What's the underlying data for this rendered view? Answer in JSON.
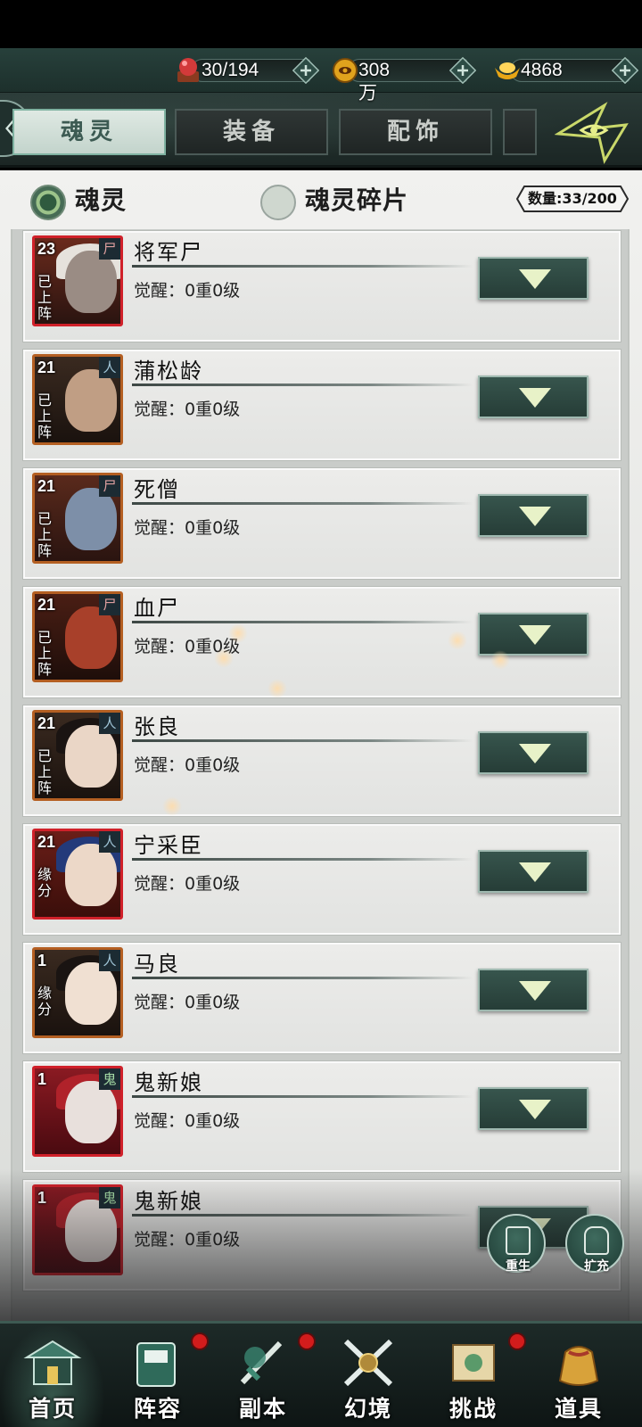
{
  "resources": [
    {
      "icon": "stamina-orb-icon",
      "value": "30/194"
    },
    {
      "icon": "coin-icon",
      "value": "308万"
    },
    {
      "icon": "gold-ingot-icon",
      "value": "4868"
    }
  ],
  "tabs": [
    {
      "label": "魂灵",
      "active": true
    },
    {
      "label": "装备",
      "active": false
    },
    {
      "label": "配饰",
      "active": false
    }
  ],
  "subtabs": [
    {
      "label": "魂灵",
      "selected": true
    },
    {
      "label": "魂灵碎片",
      "selected": false
    }
  ],
  "count_badge": "数量:33/200",
  "cards": [
    {
      "name": "将军尸",
      "level": "23",
      "status": "已上阵",
      "element": "尸",
      "awaken": "觉醒：0重0级"
    },
    {
      "name": "蒲松龄",
      "level": "21",
      "status": "已上阵",
      "element": "人",
      "awaken": "觉醒：0重0级"
    },
    {
      "name": "死僧",
      "level": "21",
      "status": "已上阵",
      "element": "尸",
      "awaken": "觉醒：0重0级"
    },
    {
      "name": "血尸",
      "level": "21",
      "status": "已上阵",
      "element": "尸",
      "awaken": "觉醒：0重0级"
    },
    {
      "name": "张良",
      "level": "21",
      "status": "已上阵",
      "element": "人",
      "awaken": "觉醒：0重0级"
    },
    {
      "name": "宁采臣",
      "level": "21",
      "status": "缘分",
      "element": "人",
      "awaken": "觉醒：0重0级"
    },
    {
      "name": "马良",
      "level": "1",
      "status": "缘分",
      "element": "人",
      "awaken": "觉醒：0重0级"
    },
    {
      "name": "鬼新娘",
      "level": "1",
      "status": "",
      "element": "鬼",
      "awaken": "觉醒：0重0级"
    },
    {
      "name": "鬼新娘",
      "level": "1",
      "status": "",
      "element": "鬼",
      "awaken": "觉醒：0重0级"
    }
  ],
  "floating": [
    {
      "label": "重生",
      "icon": "rebirth-card-icon"
    },
    {
      "label": "扩充",
      "icon": "expand-bag-icon"
    }
  ],
  "nav": [
    {
      "label": "首页",
      "icon": "home-pavilion-icon",
      "badge": false
    },
    {
      "label": "阵容",
      "icon": "lineup-book-icon",
      "badge": true
    },
    {
      "label": "副本",
      "icon": "dungeon-sword-icon",
      "badge": true
    },
    {
      "label": "幻境",
      "icon": "crossed-swords-icon",
      "badge": false
    },
    {
      "label": "挑战",
      "icon": "challenge-scroll-icon",
      "badge": true
    },
    {
      "label": "道具",
      "icon": "item-bag-icon",
      "badge": false
    }
  ]
}
